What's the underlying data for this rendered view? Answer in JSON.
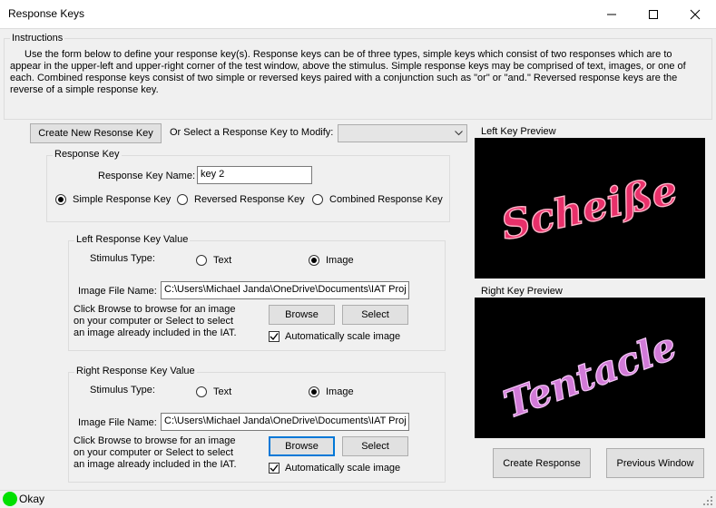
{
  "window": {
    "title": "Response Keys"
  },
  "instructions": {
    "title": "Instructions",
    "text": "Use the form below to define your response key(s).  Response keys can be of three types, simple keys which consist of two responses which are to appear in the upper-left and upper-right corner of the test window, above the stimulus.  Simple response keys may be comprised of text, images, or one of each.  Combined response keys consist of two simple or reversed keys paired with a conjunction such as \"or\" or \"and.\"  Reversed response keys are the reverse of a simple response key."
  },
  "toolbar": {
    "create_new_label": "Create New Resonse Key",
    "select_label": "Or Select a Response Key to Modify:",
    "select_value": ""
  },
  "response_key": {
    "title": "Response Key",
    "name_label": "Response Key Name:",
    "name_value": "key 2",
    "type_options": [
      "Simple Response Key",
      "Reversed Response Key",
      "Combined Response Key"
    ],
    "selected_type": "Simple Response Key"
  },
  "left_key": {
    "title": "Left Response Key Value",
    "stimulus_type_label": "Stimulus Type:",
    "type_text": "Text",
    "type_image": "Image",
    "selected": "Image",
    "file_label": "Image File Name:",
    "file_value": "C:\\Users\\Michael Janda\\OneDrive\\Documents\\IAT Proj",
    "help_text": "Click Browse to browse for an image on your computer or Select to select an image already included in the IAT.",
    "browse_label": "Browse",
    "select_label": "Select",
    "autoscale_label": "Automatically scale image",
    "autoscale_checked": true
  },
  "right_key": {
    "title": "Right Response Key Value",
    "stimulus_type_label": "Stimulus Type:",
    "type_text": "Text",
    "type_image": "Image",
    "selected": "Image",
    "file_label": "Image File Name:",
    "file_value": "C:\\Users\\Michael Janda\\OneDrive\\Documents\\IAT Proj",
    "help_text": "Click Browse to browse for an image on your computer or Select to select an image already included in the IAT.",
    "browse_label": "Browse",
    "select_label": "Select",
    "autoscale_label": "Automatically scale image",
    "autoscale_checked": true
  },
  "previews": {
    "left_title": "Left Key Preview",
    "left_word": "Scheiße",
    "left_color": "#e8306a",
    "right_title": "Right Key Preview",
    "right_word": "Tentacle",
    "right_color": "#d27ad8"
  },
  "actions": {
    "create_label": "Create Response",
    "previous_label": "Previous Window"
  },
  "status": {
    "text": "Okay",
    "indicator_color": "#00e000"
  }
}
